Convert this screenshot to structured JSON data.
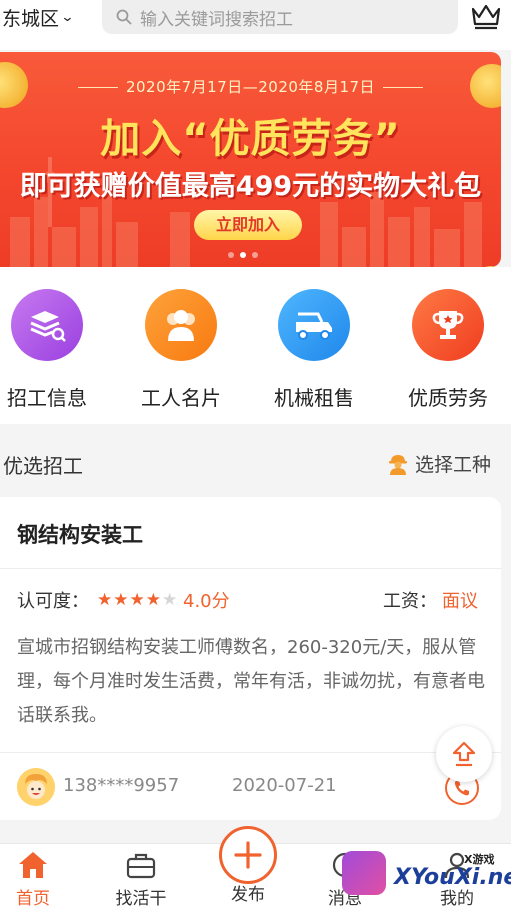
{
  "header": {
    "city": "东城区",
    "search_placeholder": "输入关键词搜索招工"
  },
  "banner": {
    "date_range": "2020年7月17日—2020年8月17日",
    "headline": "加入“优质劳务”",
    "subline": "即可获赠价值最高499元的实物大礼包",
    "button_label": "立即加入",
    "slides_total": 3,
    "active_slide": 2
  },
  "categories": [
    {
      "label": "招工信息",
      "icon": "stack-search-icon",
      "color": "#b45ce8"
    },
    {
      "label": "工人名片",
      "icon": "workers-icon",
      "color": "#fb8a1a"
    },
    {
      "label": "机械租售",
      "icon": "crane-truck-icon",
      "color": "#2f9ef5"
    },
    {
      "label": "优质劳务",
      "icon": "trophy-icon",
      "color": "#f4552a"
    }
  ],
  "section": {
    "title": "优选招工",
    "filter_label": "选择工种"
  },
  "job": {
    "title": "钢结构安装工",
    "rating_label": "认可度：",
    "rating_stars": 4,
    "rating_max": 5,
    "rating_score": "4.0分",
    "wage_label": "工资：",
    "wage_value": "面议",
    "description": "宣城市招钢结构安装工师傅数名，260-320元/天，服从管理，每个月准时发生活费，常年有活，非诚勿扰，有意者电话联系我。",
    "phone": "138****9957",
    "date": "2020-07-21"
  },
  "nav": {
    "home": "首页",
    "find_work": "找活干",
    "publish": "发布",
    "messages": "消息",
    "mine": "我的"
  },
  "watermark": {
    "site": "XYouXi.net",
    "tag": "X游戏"
  },
  "colors": {
    "accent": "#f0622e",
    "banner_red": "#f4472e"
  }
}
